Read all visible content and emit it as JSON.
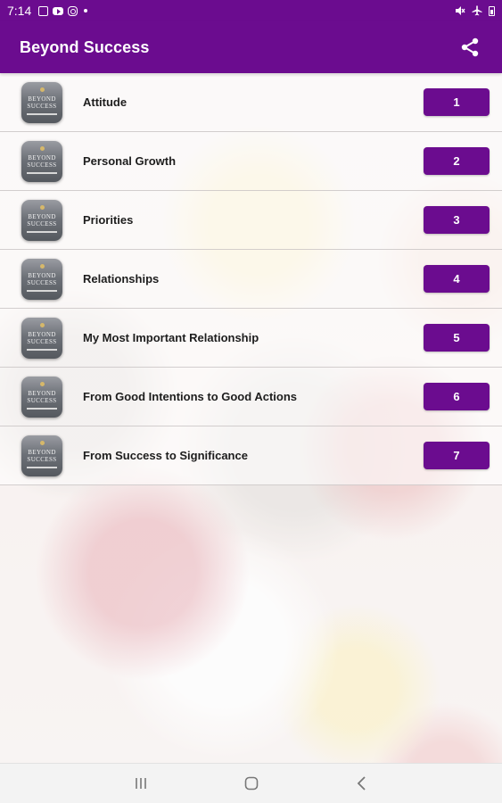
{
  "status_bar": {
    "time": "7:14",
    "left_icons": [
      "gallery-icon",
      "youtube-icon",
      "instagram-icon",
      "notification-dot-icon"
    ],
    "right_icons": [
      "mute-icon",
      "airplane-mode-icon",
      "battery-icon"
    ]
  },
  "app_bar": {
    "title": "Beyond Success",
    "action_icon": "share-icon"
  },
  "list": {
    "thumbnail_text": [
      "BEYOND",
      "SUCCESS"
    ],
    "items": [
      {
        "title": "Attitude",
        "number": "1"
      },
      {
        "title": "Personal Growth",
        "number": "2"
      },
      {
        "title": "Priorities",
        "number": "3"
      },
      {
        "title": "Relationships",
        "number": "4"
      },
      {
        "title": "My Most Important Relationship",
        "number": "5"
      },
      {
        "title": "From Good Intentions to Good Actions",
        "number": "6"
      },
      {
        "title": "From Success to Significance",
        "number": "7"
      }
    ]
  },
  "nav_bar": {
    "buttons": [
      "recent-apps-icon",
      "home-icon",
      "back-icon"
    ]
  },
  "colors": {
    "primary": "#6b0c8f",
    "button_text": "#ffffff"
  }
}
